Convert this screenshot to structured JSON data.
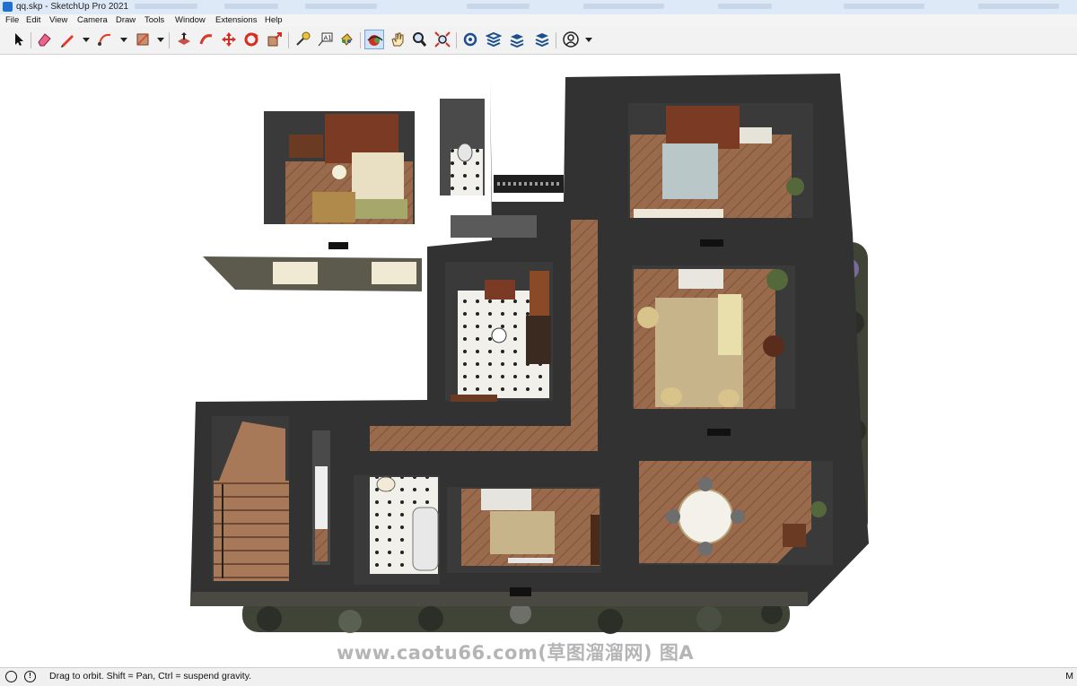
{
  "window": {
    "title": "qq.skp - SketchUp Pro 2021"
  },
  "menu": [
    "File",
    "Edit",
    "View",
    "Camera",
    "Draw",
    "Tools",
    "Window",
    "Extensions",
    "Help"
  ],
  "toolbar": {
    "tools": [
      "select-arrow-icon",
      "eraser-icon",
      "pencil-line-icon",
      "arc-icon",
      "rectangle-icon",
      "push-pull-icon",
      "follow-me-icon",
      "move-icon",
      "rotate-icon",
      "scale-icon",
      "tape-measure-icon",
      "text-label-icon",
      "paint-bucket-icon",
      "orbit-icon",
      "pan-icon",
      "zoom-icon",
      "zoom-extents-icon",
      "warehouse-icon",
      "extension-warehouse-icon",
      "layout-icon",
      "extension-manager-icon",
      "account-icon"
    ]
  },
  "canvas": {
    "watermark": "www.caotu66.com(草图溜溜网) 图A"
  },
  "status": {
    "hint": "Drag to orbit. Shift = Pan, Ctrl = suspend gravity.",
    "corner": "M"
  },
  "colors": {
    "wall": "#323232",
    "wood_floor": "#9a6a4c",
    "tile_floor": "#f2f0ea",
    "rug": "#c7b48a",
    "toolbar_active": "#cfe2f7"
  }
}
